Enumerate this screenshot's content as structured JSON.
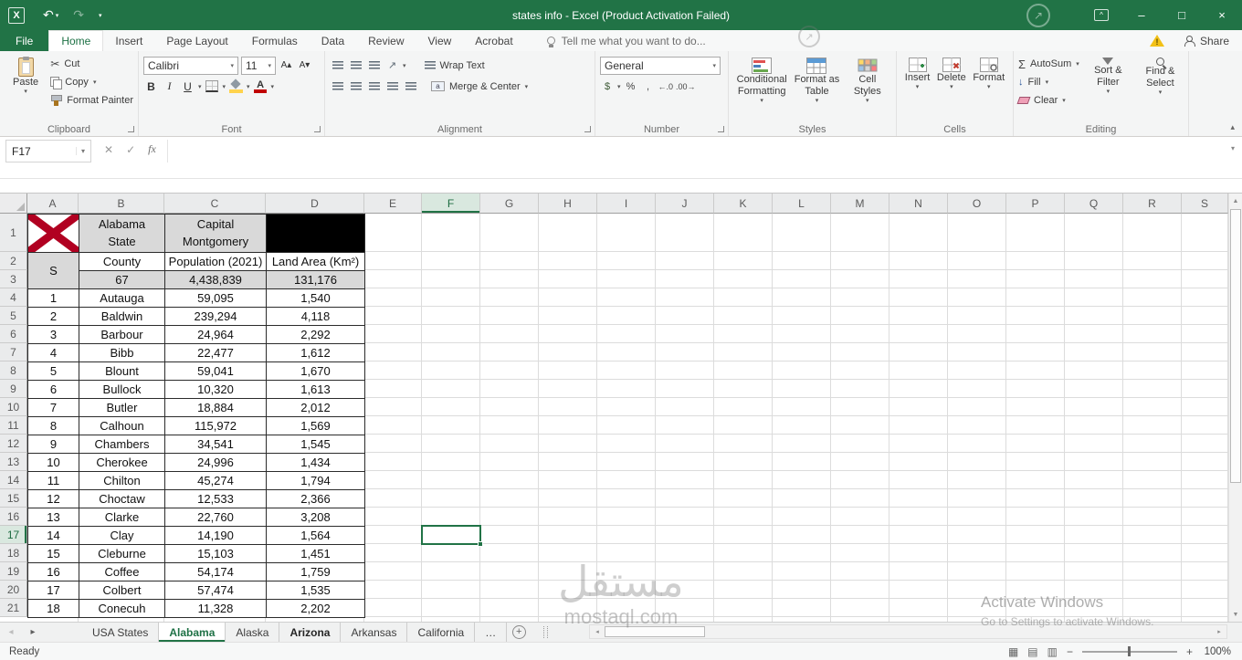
{
  "titlebar": {
    "title": "states info - Excel (Product Activation Failed)"
  },
  "ribbon_tabs": {
    "tabs": [
      {
        "label": "File",
        "file": true
      },
      {
        "label": "Home",
        "active": true
      },
      {
        "label": "Insert"
      },
      {
        "label": "Page Layout"
      },
      {
        "label": "Formulas"
      },
      {
        "label": "Data"
      },
      {
        "label": "Review"
      },
      {
        "label": "View"
      },
      {
        "label": "Acrobat"
      }
    ],
    "tell_me": "Tell me what you want to do...",
    "share": "Share"
  },
  "ribbon": {
    "clipboard": {
      "label": "Clipboard",
      "paste": "Paste",
      "cut": "Cut",
      "copy": "Copy",
      "format_painter": "Format Painter"
    },
    "font": {
      "label": "Font",
      "name": "Calibri",
      "size": "11"
    },
    "alignment": {
      "label": "Alignment",
      "wrap_text": "Wrap Text",
      "merge_center": "Merge & Center"
    },
    "number": {
      "label": "Number",
      "format": "General"
    },
    "styles": {
      "label": "Styles",
      "conditional": "Conditional Formatting",
      "format_table": "Format as Table",
      "cell_styles": "Cell Styles"
    },
    "cells": {
      "label": "Cells",
      "insert": "Insert",
      "delete": "Delete",
      "format": "Format"
    },
    "editing": {
      "label": "Editing",
      "autosum": "AutoSum",
      "fill": "Fill",
      "clear": "Clear",
      "sort_filter": "Sort & Filter",
      "find_select": "Find & Select"
    }
  },
  "formula_bar": {
    "name_box": "F17",
    "formula": ""
  },
  "grid": {
    "selected_cell": "F17",
    "selected_column": "F",
    "selected_row": "17",
    "columns": [
      "A",
      "B",
      "C",
      "D",
      "E",
      "F",
      "G",
      "H",
      "I",
      "J",
      "K",
      "L",
      "M",
      "N",
      "O",
      "P",
      "Q",
      "R",
      "S"
    ],
    "row_count": 21
  },
  "table": {
    "state": "Alabama\nState",
    "capital": "Capital\nMontgomery",
    "s_header": "S",
    "columns": {
      "county": "County",
      "population": "Population (2021)",
      "area": "Land Area (Km²)"
    },
    "totals": {
      "count": "67",
      "population": "4,438,839",
      "area": "131,176"
    },
    "counties": [
      {
        "n": "1",
        "name": "Autauga",
        "population": "59,095",
        "area": "1,540"
      },
      {
        "n": "2",
        "name": "Baldwin",
        "population": "239,294",
        "area": "4,118"
      },
      {
        "n": "3",
        "name": "Barbour",
        "population": "24,964",
        "area": "2,292"
      },
      {
        "n": "4",
        "name": "Bibb",
        "population": "22,477",
        "area": "1,612"
      },
      {
        "n": "5",
        "name": "Blount",
        "population": "59,041",
        "area": "1,670"
      },
      {
        "n": "6",
        "name": "Bullock",
        "population": "10,320",
        "area": "1,613"
      },
      {
        "n": "7",
        "name": "Butler",
        "population": "18,884",
        "area": "2,012"
      },
      {
        "n": "8",
        "name": "Calhoun",
        "population": "115,972",
        "area": "1,569"
      },
      {
        "n": "9",
        "name": "Chambers",
        "population": "34,541",
        "area": "1,545"
      },
      {
        "n": "10",
        "name": "Cherokee",
        "population": "24,996",
        "area": "1,434"
      },
      {
        "n": "11",
        "name": "Chilton",
        "population": "45,274",
        "area": "1,794"
      },
      {
        "n": "12",
        "name": "Choctaw",
        "population": "12,533",
        "area": "2,366"
      },
      {
        "n": "13",
        "name": "Clarke",
        "population": "22,760",
        "area": "3,208"
      },
      {
        "n": "14",
        "name": "Clay",
        "population": "14,190",
        "area": "1,564"
      },
      {
        "n": "15",
        "name": "Cleburne",
        "population": "15,103",
        "area": "1,451"
      },
      {
        "n": "16",
        "name": "Coffee",
        "population": "54,174",
        "area": "1,759"
      },
      {
        "n": "17",
        "name": "Colbert",
        "population": "57,474",
        "area": "1,535"
      },
      {
        "n": "18",
        "name": "Conecuh",
        "population": "11,328",
        "area": "2,202"
      }
    ]
  },
  "sheet_tabs": {
    "tabs": [
      {
        "label": "USA States"
      },
      {
        "label": "Alabama",
        "active": true
      },
      {
        "label": "Alaska"
      },
      {
        "label": "Arizona",
        "bold": true
      },
      {
        "label": "Arkansas"
      },
      {
        "label": "California"
      },
      {
        "label": "…"
      }
    ]
  },
  "status_bar": {
    "status": "Ready",
    "zoom": "100%"
  },
  "watermarks": {
    "center_ar": "مستقل",
    "center_en": "mostaql.com",
    "activate_1": "Activate Windows",
    "activate_2": "Go to Settings to activate Windows."
  },
  "colors": {
    "accent_green": "#217346",
    "flag_red": "#b10021",
    "fill_yellow": "#ffd34d",
    "font_color_red": "#c00000",
    "warning_yellow": "#f2c117",
    "table_gray": "#d9d9d9"
  },
  "icons": {
    "app": "X",
    "undo": "↶",
    "redo": "↷",
    "dropdown": "▾",
    "minimize": "–",
    "maximize": "□",
    "close": "×",
    "rdo": "^",
    "cancel": "✕",
    "enter": "✓",
    "insert_function": "fx",
    "expand_formula": "▾",
    "collapse_ribbon": "▴",
    "bold": "B",
    "italic": "I",
    "underline": "U",
    "font_bigger": "A▴",
    "font_smaller": "A▾",
    "orientation": "↗",
    "wrap_return": "↵",
    "accounting": "$",
    "percent": "%",
    "comma": ",",
    "inc_decimal": "←.0",
    "dec_decimal": ".00→",
    "autosum": "Σ",
    "fill_arrow": "↓",
    "az": "A→Z",
    "nav_left": "◂",
    "nav_right": "▸",
    "new_sheet": "+",
    "scroll_up": "▲",
    "scroll_down": "▼",
    "scroll_left": "◂",
    "scroll_right": "▸",
    "zoom_out": "−",
    "zoom_in": "+",
    "normal_view": "▦",
    "page_layout_view": "▤",
    "page_break_view": "▥",
    "logo_arrow": "↗"
  }
}
